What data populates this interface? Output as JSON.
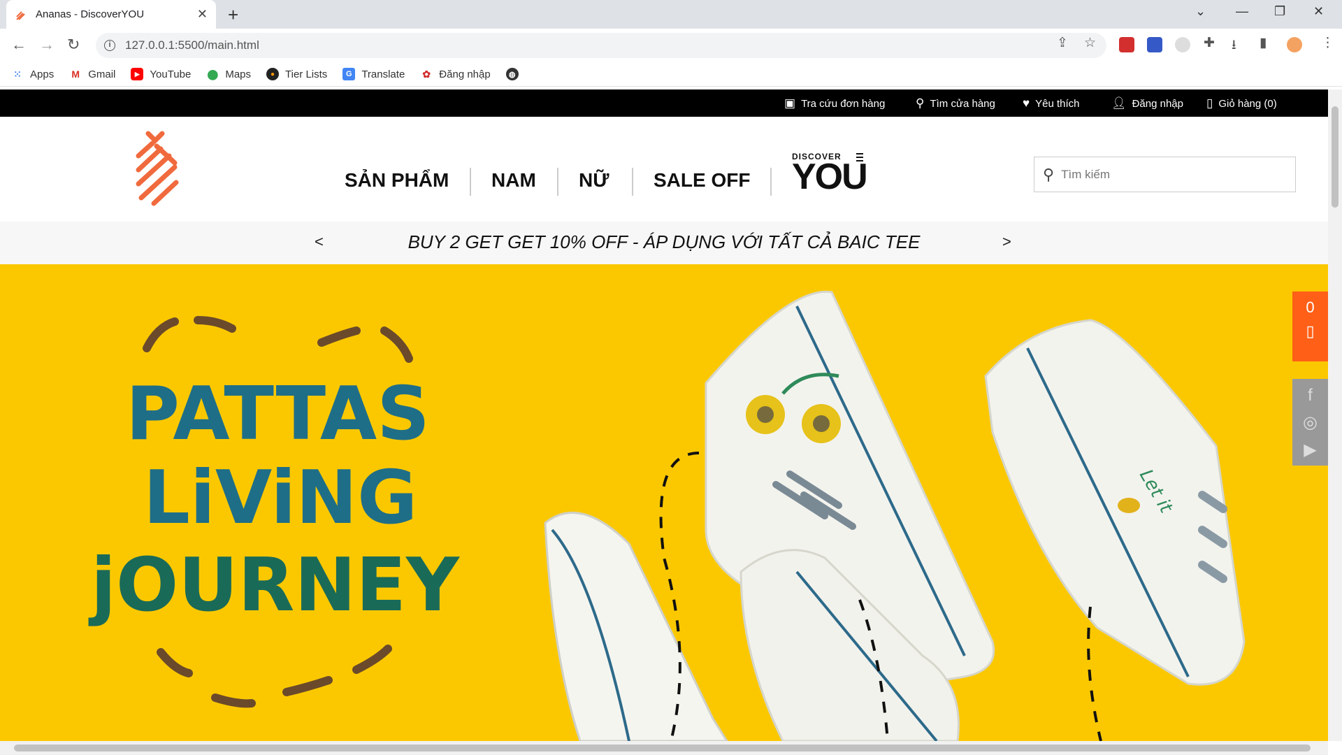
{
  "browser": {
    "tab_title": "Ananas - DiscoverYOU",
    "url": "127.0.0.1:5500/main.html",
    "bookmarks": [
      "Apps",
      "Gmail",
      "YouTube",
      "Maps",
      "Tier Lists",
      "Translate",
      "Đăng nhập"
    ]
  },
  "topbar": {
    "order_lookup": "Tra cứu đơn hàng",
    "store_finder": "Tìm cửa hàng",
    "favorites": "Yêu thích",
    "login": "Đăng nhập",
    "cart": "Giỏ hàng (0)"
  },
  "menu": {
    "products": "SẢN PHẨM",
    "men": "NAM",
    "women": "NỮ",
    "sale": "SALE OFF",
    "discover_small": "DISCOVER",
    "discover_big": "YOU"
  },
  "search": {
    "placeholder": "Tìm kiếm"
  },
  "promo": {
    "text": "BUY 2 GET GET 10% OFF - ÁP DỤNG VỚI TẤT CẢ BAIC TEE",
    "prev": "<",
    "next": ">"
  },
  "banner": {
    "line1": "PATTAS",
    "line2": "LiViNG",
    "line3": "jOURNEY",
    "shoe_text": "Let it"
  },
  "float_cart": {
    "count": "0"
  },
  "colors": {
    "accent": "#ff5f17",
    "banner_bg": "#fbc800",
    "topbar_bg": "#000000"
  }
}
